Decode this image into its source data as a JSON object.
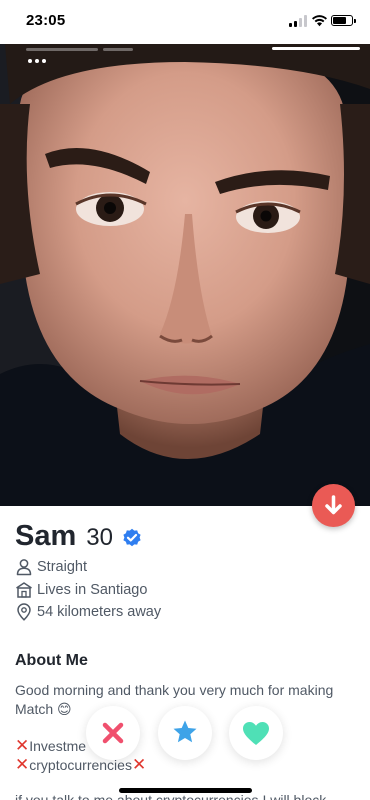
{
  "status_bar": {
    "time": "23:05",
    "battery_level": 0.75,
    "signal_bars_active": 2
  },
  "photo": {
    "progress_segments": 3,
    "active_segment": 3,
    "menu_icon": "more-dots-icon"
  },
  "collapse_button": {
    "icon": "arrow-down-icon",
    "color": "#ea5a55"
  },
  "profile": {
    "name": "Sam",
    "age": "30",
    "verified_icon": "verified-badge-icon",
    "verified_color": "#2f7ef0",
    "orientation": "Straight",
    "location": "Lives in Santiago",
    "distance": "54 kilometers away"
  },
  "about": {
    "title": "About Me",
    "bio": "Good morning and thank you very much for making Match 😊",
    "line_investments": "Investme",
    "line_crypto": "cryptocurrencies",
    "line_warning": "if you talk to me about cryptocurrencies I will block"
  },
  "actions": {
    "nope_icon": "x-icon",
    "super_like_icon": "star-icon",
    "like_icon": "heart-icon",
    "nope_color": "#f0506e",
    "super_like_color": "#3ea3e8",
    "like_color": "#4fe0b6"
  }
}
